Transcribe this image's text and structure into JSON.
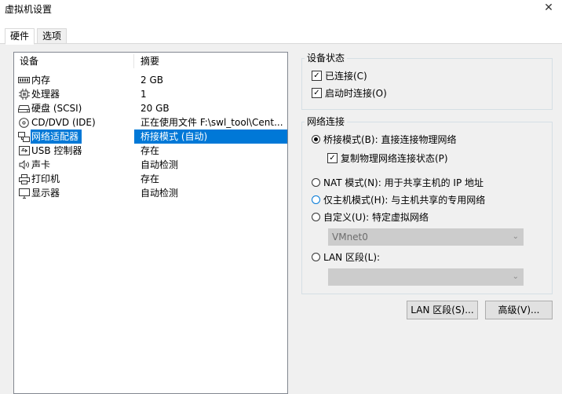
{
  "window": {
    "title": "虚拟机设置",
    "close_glyph": "✕"
  },
  "tabs": [
    {
      "label": "硬件"
    },
    {
      "label": "选项"
    }
  ],
  "device_list": {
    "col_device": "设备",
    "col_summary": "摘要",
    "rows": [
      {
        "name": "内存",
        "summary": "2 GB",
        "icon": "memory-icon"
      },
      {
        "name": "处理器",
        "summary": "1",
        "icon": "processor-icon"
      },
      {
        "name": "硬盘 (SCSI)",
        "summary": "20 GB",
        "icon": "hard-disk-icon"
      },
      {
        "name": "CD/DVD (IDE)",
        "summary": "正在使用文件 F:\\swl_tool\\Cent...",
        "icon": "cd-dvd-icon"
      },
      {
        "name": "网络适配器",
        "summary": "桥接模式 (自动)",
        "icon": "network-adapter-icon",
        "selected": true
      },
      {
        "name": "USB 控制器",
        "summary": "存在",
        "icon": "usb-icon"
      },
      {
        "name": "声卡",
        "summary": "自动检测",
        "icon": "sound-icon"
      },
      {
        "name": "打印机",
        "summary": "存在",
        "icon": "printer-icon"
      },
      {
        "name": "显示器",
        "summary": "自动检测",
        "icon": "monitor-icon"
      }
    ]
  },
  "device_status": {
    "title": "设备状态",
    "connected": {
      "label": "已连接(C)",
      "checked": true
    },
    "connect_at_power_on": {
      "label": "启动时连接(O)",
      "checked": true
    }
  },
  "network": {
    "title": "网络连接",
    "bridged": {
      "label": "桥接模式(B): 直接连接物理网络",
      "selected": true
    },
    "replicate": {
      "label": "复制物理网络连接状态(P)",
      "checked": true
    },
    "nat": {
      "label": "NAT 模式(N): 用于共享主机的 IP 地址"
    },
    "host_only": {
      "label": "仅主机模式(H): 与主机共享的专用网络"
    },
    "custom": {
      "label": "自定义(U): 特定虚拟网络"
    },
    "custom_value": "VMnet0",
    "lan": {
      "label": "LAN 区段(L):"
    },
    "lan_value": ""
  },
  "buttons": {
    "lan_segments": "LAN 区段(S)...",
    "advanced": "高级(V)..."
  }
}
